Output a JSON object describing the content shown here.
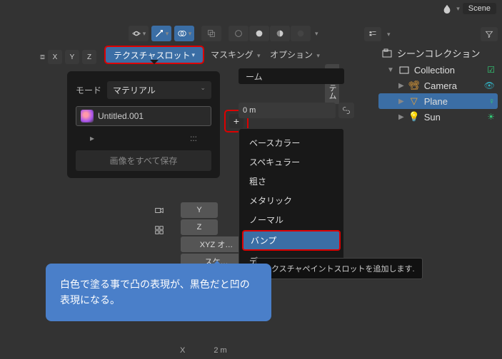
{
  "header": {
    "scene": "Scene"
  },
  "toolbar": {
    "mirror": "⧈",
    "xyz": [
      "X",
      "Y",
      "Z"
    ],
    "texture_slot": "テクスチャスロット",
    "masking": "マスキング",
    "options": "オプション"
  },
  "popup": {
    "mode_label": "モード",
    "mode_value": "マテリアル",
    "texture_name": "Untitled.001",
    "expand": "▸",
    "more": ":::",
    "save_all": "画像をすべて保存"
  },
  "context": {
    "header_unit": "0 m",
    "suffix": "ーム",
    "items": [
      "ベースカラー",
      "スペキュラー",
      "粗さ",
      "メタリック",
      "ノーマル",
      "バンプ",
      "ディ"
    ]
  },
  "axis_panel": {
    "items": [
      "Y",
      "Z",
      "XYZ オ…",
      "スケ…"
    ]
  },
  "side_tab": "アイテム",
  "outliner": {
    "scene_collection": "シーンコレクション",
    "collection": "Collection",
    "items": [
      {
        "name": "Camera",
        "icon": "camera"
      },
      {
        "name": "Plane",
        "icon": "plane",
        "selected": true
      },
      {
        "name": "Sun",
        "icon": "sun"
      }
    ]
  },
  "tooltip": "テクスチャペイントスロットを追加します.",
  "callout": "白色で塗る事で凸の表現が、黒色だと凹の表現になる。",
  "ruler": {
    "x": "X",
    "val": "2 m"
  }
}
